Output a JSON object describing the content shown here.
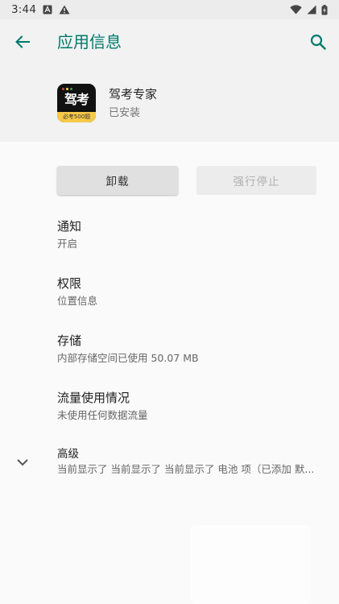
{
  "status_bar": {
    "time": "3:44",
    "icons": [
      "a-notification-icon",
      "warning-icon",
      "wifi-icon",
      "cell-signal-icon",
      "battery-charging-icon"
    ]
  },
  "app_bar": {
    "title": "应用信息",
    "back_icon": "arrow-back-icon",
    "search_icon": "search-icon"
  },
  "app": {
    "name": "驾考专家",
    "status": "已安装",
    "icon_text": "驾考",
    "icon_badge": "必考500题"
  },
  "actions": {
    "uninstall_label": "卸载",
    "force_stop_label": "强行停止"
  },
  "prefs": [
    {
      "title": "通知",
      "summary": "开启"
    },
    {
      "title": "权限",
      "summary": "位置信息"
    },
    {
      "title": "存储",
      "summary": "内部存储空间已使用 50.07 MB"
    },
    {
      "title": "流量使用情况",
      "summary": "未使用任何数据流量"
    }
  ],
  "advanced": {
    "title": "高级",
    "summary": "当前显示了 当前显示了 当前显示了 电池 项（已添加 默..."
  },
  "colors": {
    "accent": "#00796b",
    "header_bg": "#f2f2f2",
    "page_bg": "#fafafa"
  }
}
